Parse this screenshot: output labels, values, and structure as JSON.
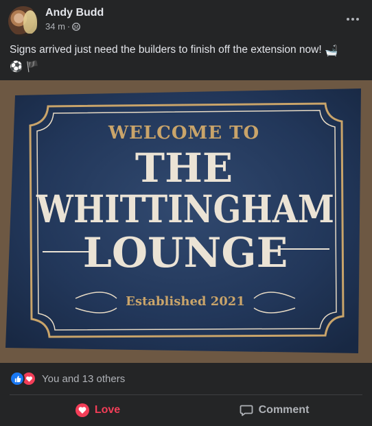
{
  "post": {
    "author": "Andy Budd",
    "time": "34 m",
    "separator": "·",
    "privacy_icon": "friends-icon",
    "more_icon": "more-options-icon",
    "text": "Signs arrived just need the builders to finish off the extension now! ",
    "emojis": [
      "🛁",
      "⚽",
      "🏴"
    ]
  },
  "image": {
    "alt_line1": "WELCOME TO",
    "alt_line2": "THE",
    "alt_line3": "WHITTINGHAM",
    "alt_line4": "LOUNGE",
    "alt_line5": "Established 2021"
  },
  "reactions": {
    "icons": [
      "like-icon",
      "love-icon"
    ],
    "count_text": "You and 13 others"
  },
  "actions": {
    "love_label": "Love",
    "comment_label": "Comment"
  },
  "colors": {
    "background": "#242526",
    "text": "#e4e6eb",
    "secondary_text": "#b0b3b8",
    "love": "#f33e58",
    "like": "#1877f2",
    "sign_blue": "#253a5c",
    "sign_gold": "#c9a46a"
  }
}
